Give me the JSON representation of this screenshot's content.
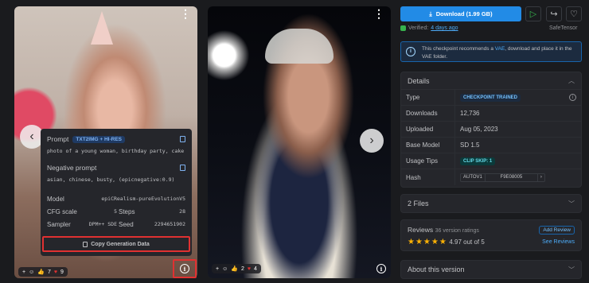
{
  "card1": {
    "nav_prev": "‹",
    "meta": {
      "prompt_label": "Prompt",
      "prompt_badge": "TXT2IMG + HI-RES",
      "prompt_text": "photo of a young woman, birthday party, cake",
      "negative_label": "Negative prompt",
      "negative_text": "asian, chinese, busty, (epicnegative:0.9)",
      "model_label": "Model",
      "model_value": "epiCRealism-pureEvolutionV5",
      "cfg_label": "CFG scale",
      "cfg_value": "5",
      "steps_label": "Steps",
      "steps_value": "28",
      "sampler_label": "Sampler",
      "sampler_value": "DPM++ SDE",
      "seed_label": "Seed",
      "seed_value": "2294651902"
    },
    "copy_button": "Copy Generation Data",
    "reactions": {
      "plus": "+",
      "thumbs": "7",
      "hearts": "9"
    },
    "info_icon": "i"
  },
  "card2": {
    "nav_next": "›",
    "reactions": {
      "plus": "+",
      "thumbs": "2",
      "hearts": "4"
    },
    "info_icon": "i"
  },
  "download": {
    "label": "Download (1.99 GB)"
  },
  "verified": {
    "text": "Verified:",
    "when": "4 days ago",
    "safetensor": "SafeTensor"
  },
  "notice": {
    "pre": "This checkpoint recommends a ",
    "link": "VAE",
    "post": ", download and place it in the VAE folder."
  },
  "details": {
    "title": "Details",
    "rows": [
      {
        "key": "Type",
        "value": "CHECKPOINT TRAINED"
      },
      {
        "key": "Downloads",
        "value": "12,736"
      },
      {
        "key": "Uploaded",
        "value": "Aug 05, 2023"
      },
      {
        "key": "Base Model",
        "value": "SD 1.5"
      },
      {
        "key": "Usage Tips",
        "value": "CLIP SKIP: 1"
      },
      {
        "key": "Hash",
        "value": "AUTOV1",
        "hash": "F9E08005"
      }
    ]
  },
  "files": {
    "title": "2 Files"
  },
  "reviews": {
    "title": "Reviews",
    "count": "36 version ratings",
    "stars": "★★★★★",
    "score": "4.97 out of 5",
    "add": "Add Review",
    "see": "See Reviews"
  },
  "about": {
    "title": "About this version"
  },
  "colors": {
    "accent": "#228be6",
    "highlight": "#e03131",
    "star": "#fab005"
  }
}
